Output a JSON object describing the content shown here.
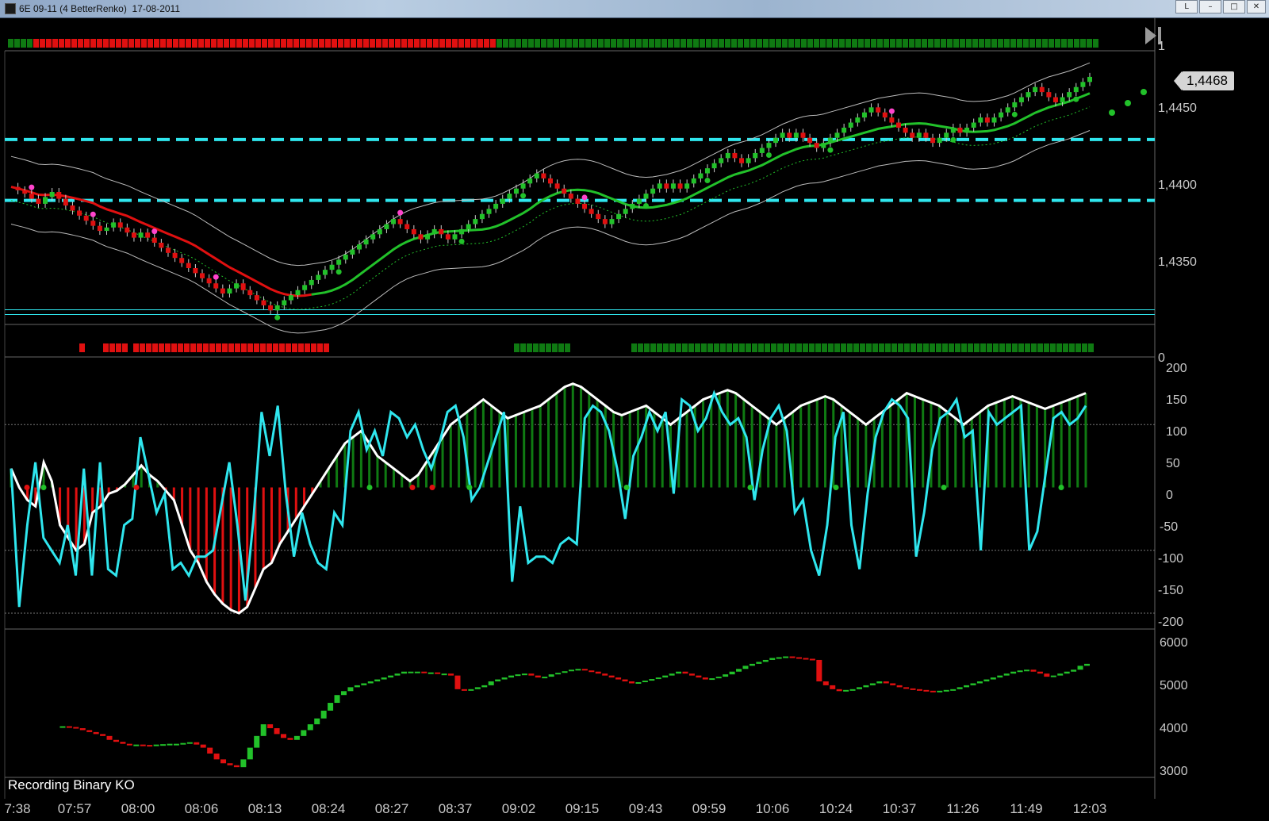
{
  "window": {
    "title": "6E 09-11 (4 BetterRenko)  17-08-2011",
    "controls": [
      "L",
      "–",
      "□",
      "✕"
    ]
  },
  "price_tag": "1,4468",
  "recording_label": "Recording Binary KO",
  "axes": {
    "trend_bar": "1",
    "price": [
      "1,4450",
      "1,4400",
      "1,4350"
    ],
    "signal_bar": "0",
    "oscillator": [
      "200",
      "150",
      "100",
      "50",
      "0",
      "-50",
      "-100",
      "-150",
      "-200"
    ],
    "volume": [
      "6000",
      "5000",
      "4000",
      "3000"
    ]
  },
  "time_labels": [
    "7:38",
    "07:57",
    "08:00",
    "08:06",
    "08:13",
    "08:24",
    "08:27",
    "08:37",
    "09:02",
    "09:15",
    "09:43",
    "09:59",
    "10:06",
    "10:24",
    "10:37",
    "11:26",
    "11:49",
    "12:03"
  ],
  "colors": {
    "up": "#22c12a",
    "down": "#e01010",
    "cyan": "#2fe6ee",
    "white": "#ffffff",
    "dark_green": "#0f7a12",
    "pink": "#ff44cc"
  },
  "icons": [
    "skip-to-end-icon",
    "window-app-icon"
  ],
  "chart_data": [
    {
      "type": "line",
      "ylim": [
        1.432,
        1.447
      ],
      "price_series": [
        1.4398,
        1.4396,
        1.4394,
        1.4391,
        1.4388,
        1.4392,
        1.4395,
        1.4391,
        1.4387,
        1.4384,
        1.4381,
        1.4378,
        1.4375,
        1.4372,
        1.4374,
        1.4377,
        1.4374,
        1.4371,
        1.4368,
        1.4371,
        1.4368,
        1.4365,
        1.4362,
        1.4359,
        1.4356,
        1.4353,
        1.435,
        1.4347,
        1.4344,
        1.4341,
        1.4338,
        1.4335,
        1.4338,
        1.4341,
        1.4337,
        1.4334,
        1.4331,
        1.4328,
        1.4325,
        1.4328,
        1.4331,
        1.4334,
        1.4337,
        1.434,
        1.4343,
        1.4346,
        1.4349,
        1.4352,
        1.4355,
        1.4358,
        1.4361,
        1.4364,
        1.4367,
        1.437,
        1.4373,
        1.4376,
        1.4379,
        1.4376,
        1.4373,
        1.437,
        1.4367,
        1.437,
        1.4373,
        1.437,
        1.4367,
        1.437,
        1.4373,
        1.4376,
        1.4379,
        1.4382,
        1.4385,
        1.4388,
        1.4391,
        1.4394,
        1.4397,
        1.44,
        1.4403,
        1.4406,
        1.4403,
        1.44,
        1.4397,
        1.4394,
        1.4391,
        1.4388,
        1.4385,
        1.4382,
        1.4379,
        1.4376,
        1.4379,
        1.4382,
        1.4385,
        1.4388,
        1.4391,
        1.4394,
        1.4397,
        1.44,
        1.4397,
        1.44,
        1.4397,
        1.44,
        1.4403,
        1.4406,
        1.4409,
        1.4412,
        1.4415,
        1.4418,
        1.4415,
        1.4412,
        1.4415,
        1.4418,
        1.4421,
        1.4424,
        1.4427,
        1.443,
        1.4427,
        1.443,
        1.4427,
        1.4424,
        1.4421,
        1.4424,
        1.4427,
        1.443,
        1.4433,
        1.4436,
        1.4439,
        1.4442,
        1.4445,
        1.4442,
        1.4439,
        1.4436,
        1.4433,
        1.443,
        1.4427,
        1.443,
        1.4427,
        1.4424,
        1.4427,
        1.443,
        1.4433,
        1.443,
        1.4433,
        1.4436,
        1.4439,
        1.4436,
        1.4439,
        1.4442,
        1.4445,
        1.4448,
        1.4451,
        1.4454,
        1.4457,
        1.4454,
        1.4451,
        1.4448,
        1.4451,
        1.4454,
        1.4457,
        1.446,
        1.4463
      ],
      "levels": [
        1.4426,
        1.439,
        1.4324
      ]
    },
    {
      "type": "line",
      "ylim": [
        -200,
        200
      ],
      "series": [
        {
          "values": [
            30,
            0,
            -20,
            -30,
            40,
            10,
            -60,
            -80,
            -100,
            -90,
            -40,
            -30,
            -10,
            -5,
            5,
            20,
            35,
            20,
            10,
            -5,
            -20,
            -60,
            -100,
            -120,
            -150,
            -170,
            -185,
            -195,
            -200,
            -190,
            -160,
            -130,
            -120,
            -90,
            -70,
            -50,
            -30,
            -10,
            10,
            30,
            50,
            70,
            80,
            90,
            70,
            50,
            40,
            30,
            20,
            10,
            20,
            40,
            60,
            80,
            100,
            110,
            120,
            130,
            140,
            130,
            120,
            110,
            115,
            120,
            125,
            130,
            140,
            150,
            160,
            165,
            160,
            150,
            140,
            130,
            120,
            115,
            120,
            125,
            130,
            120,
            110,
            100,
            110,
            120,
            130,
            140,
            145,
            150,
            155,
            150,
            140,
            130,
            120,
            110,
            100,
            110,
            120,
            130,
            135,
            140,
            145,
            140,
            130,
            120,
            110,
            100,
            110,
            120,
            130,
            140,
            150,
            145,
            140,
            135,
            130,
            120,
            110,
            100,
            110,
            120,
            130,
            135,
            140,
            145,
            140,
            135,
            130,
            125,
            130,
            135,
            140,
            145,
            150
          ]
        },
        {
          "values": [
            30,
            -190,
            -60,
            40,
            -80,
            -100,
            -120,
            -60,
            -140,
            30,
            -140,
            40,
            -130,
            -140,
            -60,
            -50,
            80,
            20,
            -40,
            -10,
            -130,
            -120,
            -140,
            -110,
            -110,
            -100,
            -30,
            40,
            -60,
            -180,
            -50,
            120,
            50,
            130,
            -10,
            -110,
            -40,
            -90,
            -120,
            -130,
            -40,
            -60,
            90,
            120,
            60,
            90,
            50,
            120,
            110,
            80,
            100,
            60,
            30,
            70,
            120,
            130,
            80,
            -20,
            0,
            40,
            80,
            120,
            -150,
            -30,
            -120,
            -110,
            -110,
            -120,
            -90,
            -80,
            -90,
            110,
            130,
            120,
            90,
            30,
            -50,
            50,
            80,
            120,
            90,
            120,
            -10,
            140,
            130,
            90,
            110,
            150,
            120,
            100,
            110,
            80,
            -20,
            60,
            110,
            130,
            90,
            -40,
            -20,
            -100,
            -140,
            -60,
            80,
            120,
            -60,
            -130,
            -10,
            80,
            120,
            140,
            130,
            110,
            -110,
            -40,
            60,
            110,
            120,
            140,
            80,
            90,
            -100,
            120,
            100,
            110,
            120,
            130,
            -100,
            -70,
            20,
            110,
            120,
            100,
            110,
            130
          ]
        }
      ]
    },
    {
      "type": "bar",
      "ylim": [
        2600,
        6200
      ],
      "values": [
        3850,
        3850,
        3830,
        3800,
        3750,
        3700,
        3650,
        3600,
        3500,
        3450,
        3400,
        3380,
        3380,
        3370,
        3360,
        3380,
        3390,
        3400,
        3400,
        3420,
        3440,
        3380,
        3300,
        3150,
        3000,
        2900,
        2850,
        2800,
        3000,
        3300,
        3600,
        3900,
        3800,
        3650,
        3550,
        3500,
        3600,
        3750,
        3900,
        4050,
        4250,
        4450,
        4650,
        4750,
        4850,
        4900,
        4950,
        5000,
        5050,
        5100,
        5150,
        5200,
        5250,
        5250,
        5250,
        5230,
        5230,
        5200,
        5200,
        5150,
        4800,
        4780,
        4800,
        4850,
        4900,
        5000,
        5050,
        5100,
        5150,
        5180,
        5200,
        5150,
        5100,
        5120,
        5180,
        5220,
        5260,
        5300,
        5320,
        5280,
        5250,
        5200,
        5150,
        5100,
        5050,
        5000,
        4950,
        4980,
        5020,
        5060,
        5100,
        5150,
        5200,
        5250,
        5200,
        5150,
        5100,
        5050,
        5080,
        5120,
        5180,
        5250,
        5320,
        5400,
        5450,
        5500,
        5550,
        5600,
        5620,
        5640,
        5620,
        5600,
        5580,
        5550,
        5000,
        4900,
        4800,
        4750,
        4780,
        4800,
        4850,
        4900,
        4950,
        5000,
        4950,
        4900,
        4850,
        4820,
        4800,
        4780,
        4760,
        4750,
        4760,
        4780,
        4800,
        4850,
        4900,
        4950,
        5000,
        5050,
        5100,
        5150,
        5200,
        5250,
        5280,
        5300,
        5250,
        5200,
        5120,
        5150,
        5200,
        5250,
        5300,
        5400,
        5450
      ]
    }
  ]
}
